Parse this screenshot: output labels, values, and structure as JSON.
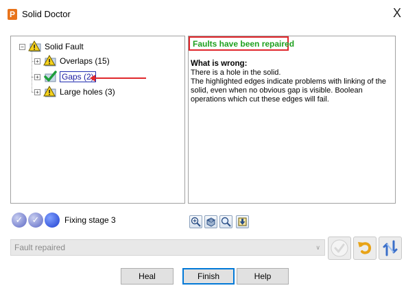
{
  "window": {
    "title": "Solid Doctor",
    "close_glyph": "X"
  },
  "tree": {
    "root": {
      "label": "Solid Fault",
      "expander": "−",
      "icon": "warning-sign-icon"
    },
    "children": [
      {
        "label": "Overlaps (15)",
        "expander": "+",
        "icon": "warning-sign-icon",
        "selected": false
      },
      {
        "label": "Gaps (2)",
        "expander": "+",
        "icon": "green-check-shield-icon",
        "selected": true
      },
      {
        "label": "Large holes (3)",
        "expander": "+",
        "icon": "warning-sign-icon",
        "selected": false
      }
    ]
  },
  "info": {
    "status": "Faults have been repaired",
    "heading": "What is wrong:",
    "lines": [
      "There is a hole in the solid.",
      "The highlighted edges indicate problems with linking of the solid, even when no obvious gap is visible. Boolean operations which cut these edges will fail."
    ]
  },
  "stage": {
    "label": "Fixing stage 3"
  },
  "fault_select": {
    "value": "Fault repaired"
  },
  "buttons": {
    "heal": "Heal",
    "finish": "Finish",
    "help": "Help"
  },
  "colors": {
    "status_green": "#1ea01e",
    "highlight_red": "#e0262a",
    "selection_blue": "#1e2bb0"
  }
}
